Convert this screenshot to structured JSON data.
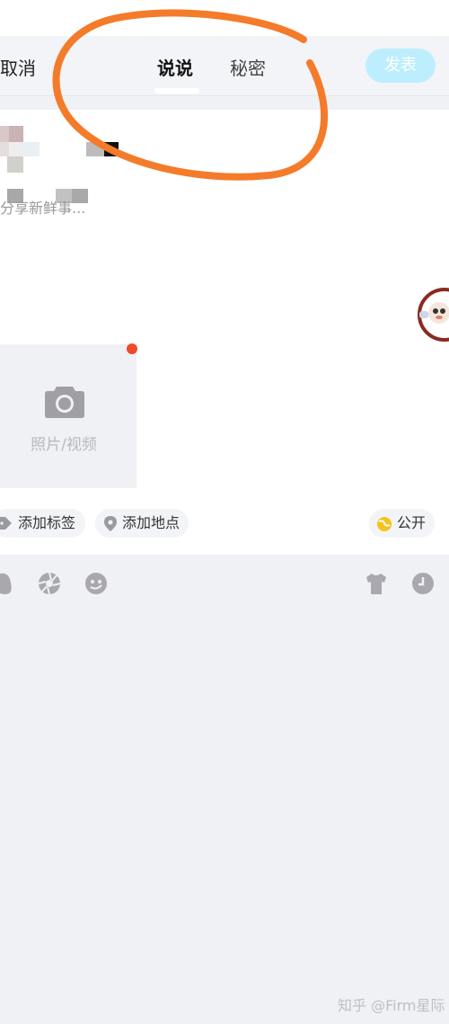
{
  "header": {
    "cancel_label": "取消",
    "tabs": [
      {
        "label": "说说",
        "active": true
      },
      {
        "label": "秘密",
        "active": false
      }
    ],
    "publish_label": "发表",
    "publish_color": "#bdeefe"
  },
  "composer": {
    "placeholder": "分享新鲜事..."
  },
  "media": {
    "photo_label": "照片/视频",
    "camera_icon": "camera-icon",
    "badge_color": "#f04a2a"
  },
  "chips": {
    "tag_label": "添加标签",
    "location_label": "添加地点",
    "visibility_label": "公开"
  },
  "toolbar": {
    "icons": [
      "qq-icon",
      "shutter-icon",
      "sticker-face-icon",
      "tshirt-icon",
      "clock-icon"
    ]
  },
  "watermark": "知乎 @Firm星际",
  "colors": {
    "annotation": "#f47b2a",
    "background": "#f0f1f5"
  }
}
